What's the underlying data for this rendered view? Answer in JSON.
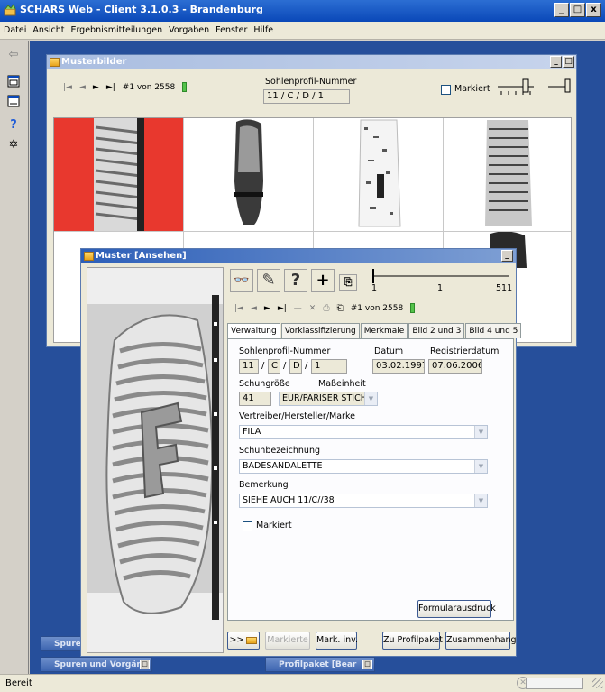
{
  "app": {
    "title": "SCHARS Web - Client 3.1.0.3 - Brandenburg"
  },
  "window_buttons": {
    "minimize": "_",
    "restore": "□",
    "close": "x"
  },
  "menu": [
    "Datei",
    "Ansicht",
    "Ergebnismitteilungen",
    "Vorgaben",
    "Fenster",
    "Hilfe"
  ],
  "status": {
    "text": "Bereit"
  },
  "musterbilder": {
    "title": "Musterbilder",
    "record_counter": "#1 von 2558",
    "sohlenprofil_label": "Sohlenprofil-Nummer",
    "profile_parts": [
      "11",
      "C",
      "D",
      "1"
    ],
    "separator": "/",
    "markiert_label": "Markiert",
    "minimize": "_",
    "restore": "□"
  },
  "ansehen": {
    "title": "Muster [Ansehen]",
    "minimize": "_",
    "toolbar": {
      "view": "👓",
      "edit": "✎",
      "help": "?",
      "add": "+",
      "copy": "⎘"
    },
    "slider": {
      "min": "1",
      "value": "1",
      "max": "511",
      "position_fraction": 0.0
    },
    "nav_counter": "#1 von 2558",
    "tabs": [
      "Verwaltung",
      "Vorklassifizierung",
      "Merkmale",
      "Bild 2 und 3",
      "Bild 4 und 5"
    ],
    "form": {
      "sohlenprofil_label": "Sohlenprofil-Nummer",
      "profile_parts": [
        "11",
        "C",
        "D",
        "1"
      ],
      "separator": "/",
      "datum_label": "Datum",
      "datum": "03.02.1997",
      "registrierdatum_label": "Registrierdatum",
      "registrierdatum": "07.06.2006",
      "schuhgroesse_label": "Schuhgröße",
      "schuhgroesse": "41",
      "masseinheit_label": "Maßeinheit",
      "masseinheit": "EUR/PARISER STICH",
      "vertreiber_label": "Vertreiber/Hersteller/Marke",
      "vertreiber": "FILA",
      "schuhbezeichnung_label": "Schuhbezeichnung",
      "schuhbezeichnung": "BADESANDALETTE",
      "bemerkung_label": "Bemerkung",
      "bemerkung": "SIEHE AUCH 11/C//38",
      "markiert_label": "Markiert",
      "formular_button": "Formularausdruck"
    },
    "bottom": {
      "arrows": ">>",
      "markierte": "Markierte",
      "mark_inv": "Mark. inv.",
      "zu_profilpaket": "Zu Profilpaket",
      "zusammenhang": "Zusammenhang"
    }
  },
  "minimized": {
    "spuren": "Spuren",
    "spuren_vorgaenge": "Spuren und Vorgän",
    "profilpaket": "Profilpaket [Bear"
  },
  "colors": {
    "mdi_background": "#264f9b",
    "selected_cell": "#e8382e",
    "title_blue": "#0a48b8"
  }
}
